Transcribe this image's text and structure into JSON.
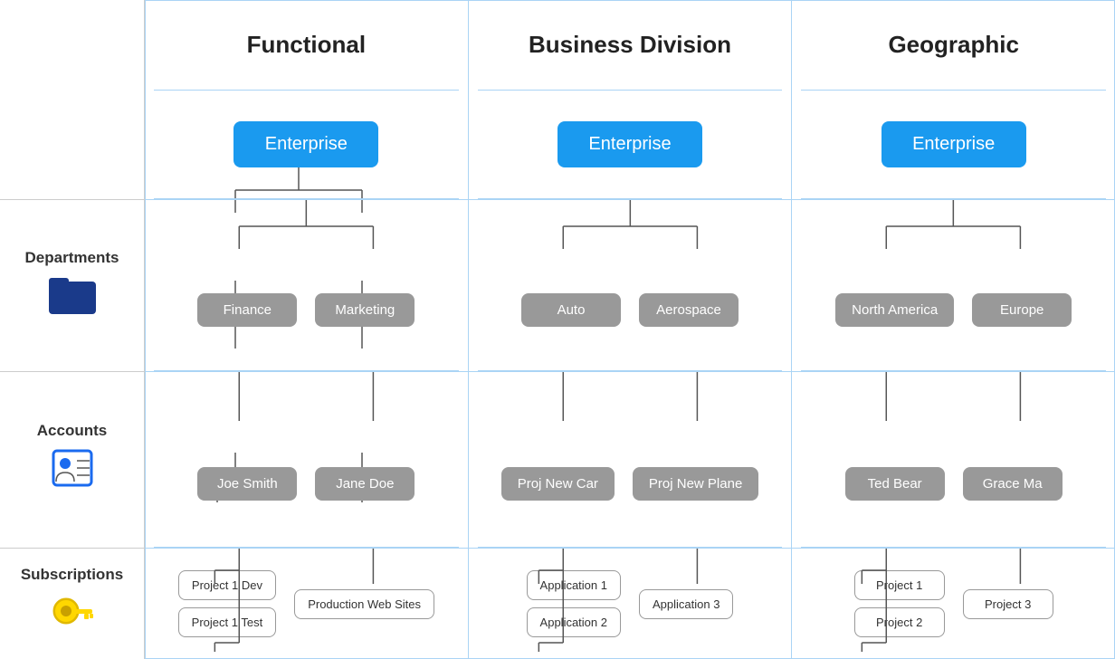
{
  "columns": {
    "functional": {
      "header": "Functional",
      "enterprise": "Enterprise",
      "depts": [
        "Finance",
        "Marketing"
      ],
      "accounts": [
        "Joe Smith",
        "Jane Doe"
      ],
      "subscriptions_left": [
        "Project 1 Dev",
        "Project 1 Test"
      ],
      "subscriptions_right": [
        "Production Web Sites"
      ]
    },
    "business": {
      "header": "Business Division",
      "enterprise": "Enterprise",
      "depts": [
        "Auto",
        "Aerospace"
      ],
      "accounts": [
        "Proj New Car",
        "Proj New Plane"
      ],
      "subscriptions_left": [
        "Application 1",
        "Application 2"
      ],
      "subscriptions_right": [
        "Application 3"
      ]
    },
    "geographic": {
      "header": "Geographic",
      "enterprise": "Enterprise",
      "depts": [
        "North America",
        "Europe"
      ],
      "accounts": [
        "Ted Bear",
        "Grace Ma"
      ],
      "subscriptions_left": [
        "Project 1",
        "Project 2"
      ],
      "subscriptions_right": [
        "Project 3"
      ]
    }
  },
  "labels": {
    "departments": "Departments",
    "accounts": "Accounts",
    "subscriptions": "Subscriptions"
  }
}
